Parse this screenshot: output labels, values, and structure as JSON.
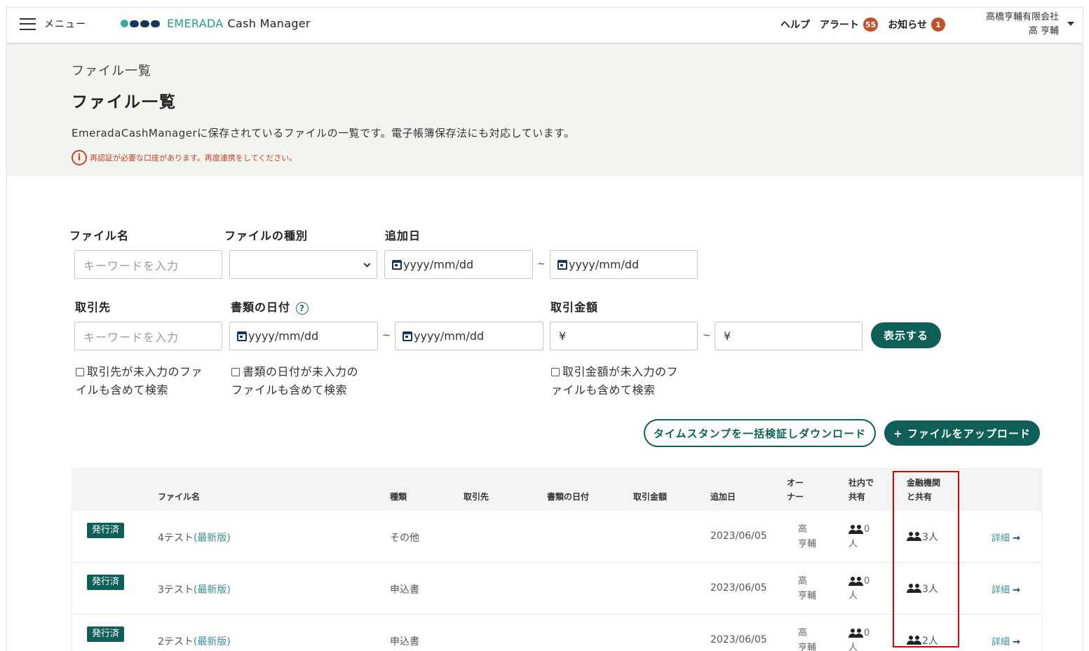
{
  "header": {
    "menu_label": "メニュー",
    "brand": "EMERADA",
    "product": "Cash Manager",
    "help": "ヘルプ",
    "alert_label": "アラート",
    "alert_count": "55",
    "notice_label": "お知らせ",
    "notice_count": "1",
    "company": "高橋亨輔有限会社",
    "user": "高 亨輔"
  },
  "intro": {
    "breadcrumb": "ファイル一覧",
    "title": "ファイル一覧",
    "description": "EmeradaCashManagerに保存されているファイルの一覧です。電子帳簿保存法にも対応しています。",
    "warning": "再認証が必要な口座があります。再度連携をしてください。"
  },
  "form": {
    "file_name_label": "ファイル名",
    "file_name_placeholder": "キーワードを入力",
    "file_type_label": "ファイルの種別",
    "added_date_label": "追加日",
    "date_placeholder": "yyyy/mm/dd",
    "tilde": "~",
    "partner_label": "取引先",
    "partner_placeholder": "キーワードを入力",
    "doc_date_label": "書類の日付",
    "amount_label": "取引金額",
    "yen": "¥",
    "show_button": "表示する",
    "chk_partner_1": "取引先が未入力のファ",
    "chk_partner_2": "イルも含めて検索",
    "chk_docdate_1": "書類の日付が未入力の",
    "chk_docdate_2": "ファイルも含めて検索",
    "chk_amount_1": "取引金額が未入力のフ",
    "chk_amount_2": "ァイルも含めて検索",
    "verify_button": "タイムスタンプを一括検証しダウンロード",
    "upload_button": "+ ファイルをアップロード"
  },
  "table": {
    "headers": {
      "file_name": "ファイル名",
      "type": "種類",
      "partner": "取引先",
      "doc_date": "書類の日付",
      "amount": "取引金額",
      "added": "追加日",
      "owner_1": "オー",
      "owner_2": "ナー",
      "internal_1": "社内で",
      "internal_2": "共有",
      "bank_1": "金融機関",
      "bank_2": "と共有"
    },
    "rows": [
      {
        "status": "発行済",
        "name": "4テスト",
        "latest": "(最新版)",
        "type": "その他",
        "added": "2023/06/05",
        "owner_1": "高",
        "owner_2": "亨輔",
        "internal_count": "0",
        "internal_unit": "人",
        "bank_share": "3人",
        "detail": "詳細"
      },
      {
        "status": "発行済",
        "name": "3テスト",
        "latest": "(最新版)",
        "type": "申込書",
        "added": "2023/06/05",
        "owner_1": "高",
        "owner_2": "亨輔",
        "internal_count": "0",
        "internal_unit": "人",
        "bank_share": "3人",
        "detail": "詳細"
      },
      {
        "status": "発行済",
        "name": "2テスト",
        "latest": "(最新版)",
        "type": "申込書",
        "added": "2023/06/05",
        "owner_1": "高",
        "owner_2": "亨輔",
        "internal_count": "0",
        "internal_unit": "人",
        "bank_share": "2人",
        "detail": "詳細"
      }
    ]
  },
  "colors": {
    "primary": "#0f5f58",
    "brand_teal": "#1e9e98",
    "badge": "#c2512b",
    "warning": "#c9412b",
    "highlight": "#e00000"
  }
}
